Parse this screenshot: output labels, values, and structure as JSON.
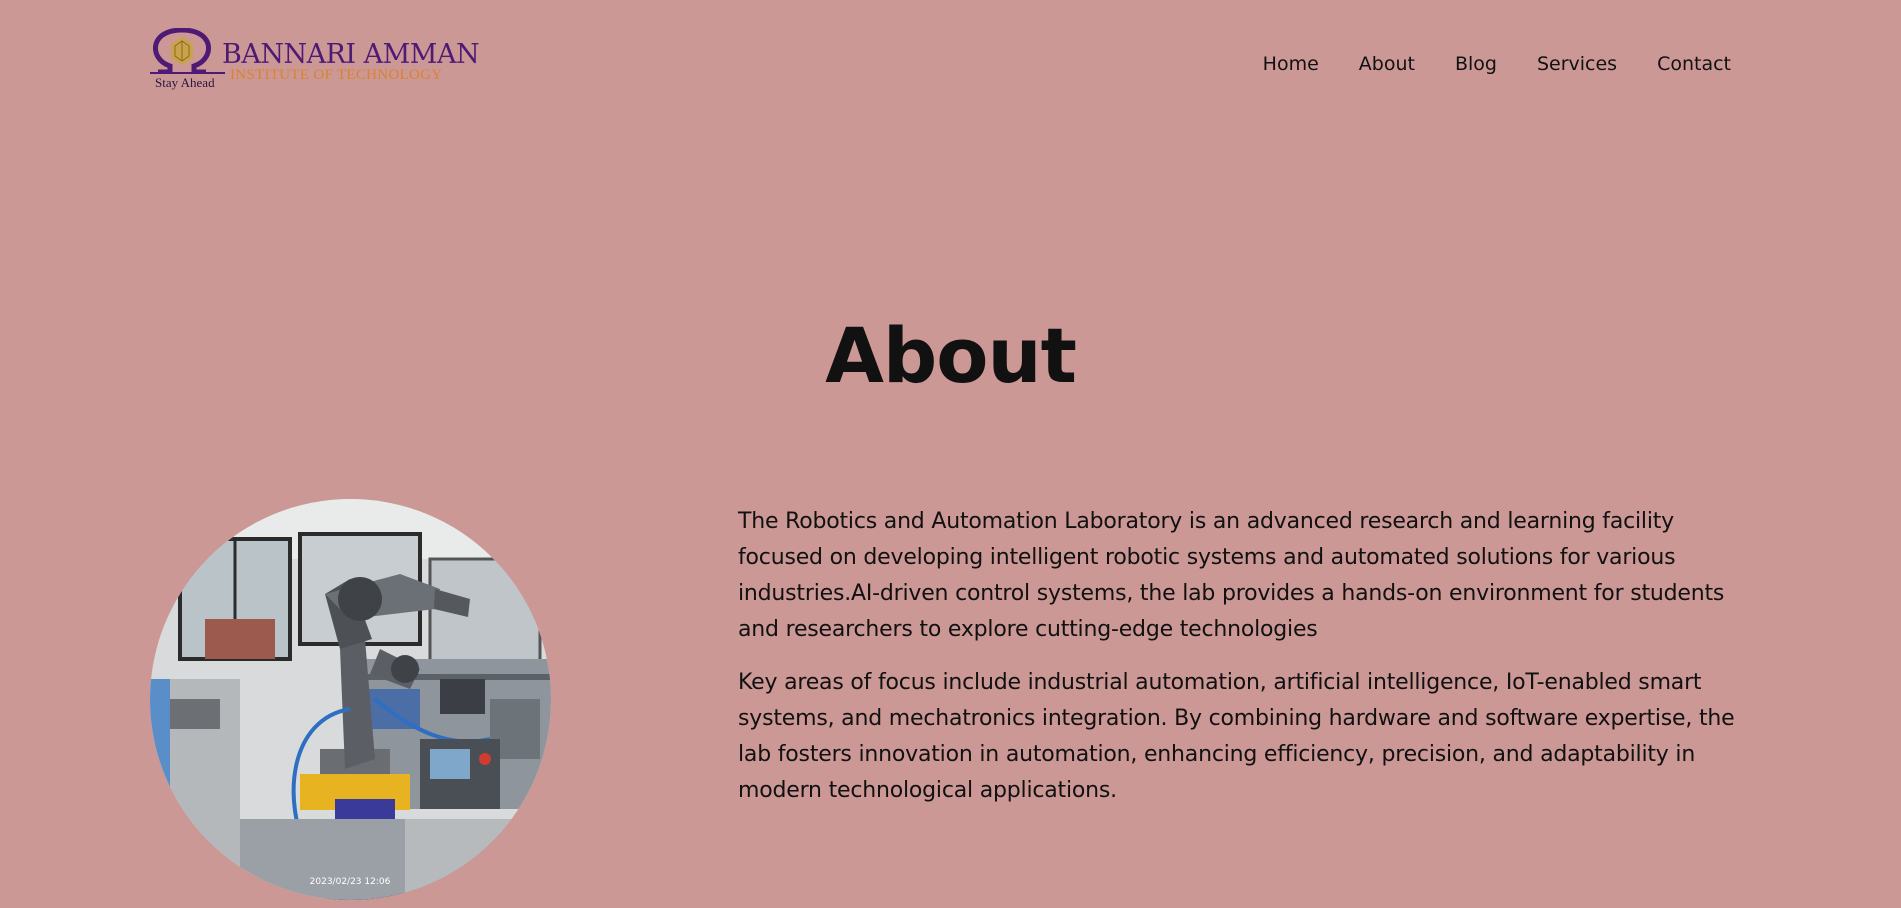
{
  "header": {
    "logo": {
      "name": "BANNARI AMMAN",
      "subtitle": "INSTITUTE OF TECHNOLOGY",
      "tagline": "Stay Ahead",
      "colors": {
        "primary": "#4e1a74",
        "secondary": "#d9832c",
        "emblem": "#c9a24a"
      }
    },
    "nav": [
      {
        "label": "Home"
      },
      {
        "label": "About"
      },
      {
        "label": "Blog"
      },
      {
        "label": "Services"
      },
      {
        "label": "Contact"
      }
    ]
  },
  "main": {
    "title": "About",
    "photo": {
      "description_icon": "robot-arm-photo",
      "timestamp": "2023/02/23 12:06"
    },
    "paragraphs": [
      "The Robotics and Automation Laboratory is an advanced research and learning facility focused on developing intelligent robotic systems and automated solutions for various industries.AI-driven control systems, the lab provides a hands-on environment for students and researchers to explore cutting-edge technologies",
      "Key areas of focus include industrial automation, artificial intelligence, IoT-enabled smart systems, and mechatronics integration. By combining hardware and software expertise, the lab fosters innovation in automation, enhancing efficiency, precision, and adaptability in modern technological applications."
    ]
  },
  "colors": {
    "background": "#cc9896",
    "text": "#111111"
  }
}
